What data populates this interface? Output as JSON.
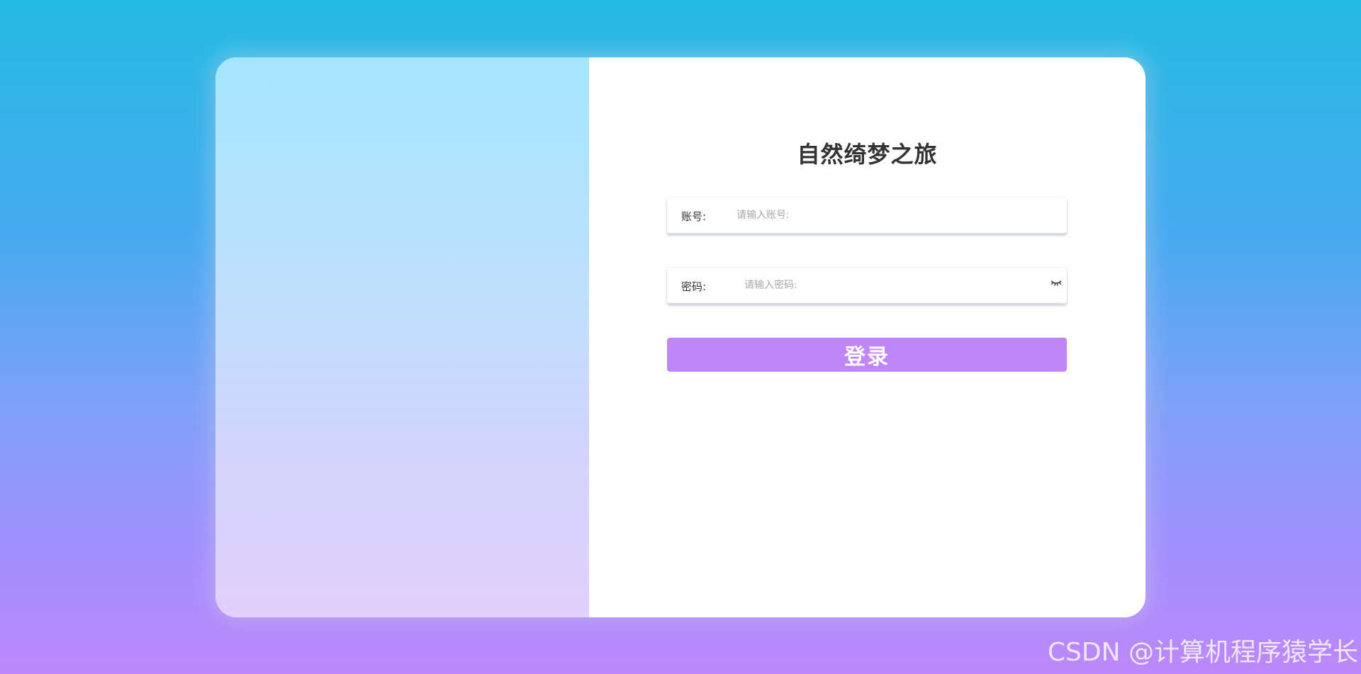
{
  "login": {
    "title": "自然绮梦之旅",
    "account": {
      "label": "账号:",
      "placeholder": "请输入账号:",
      "value": ""
    },
    "password": {
      "label": "密码:",
      "placeholder": "请输入密码:",
      "value": "",
      "toggle_icon": "eye-closed-icon"
    },
    "submit_label": "登录"
  },
  "watermark": "CSDN @计算机程序猿学长",
  "colors": {
    "button": "#be86f9",
    "title_text": "#333333",
    "left_panel_top": "#a4e6fd",
    "left_panel_bottom": "#e2d0fe",
    "background_top": "#24bae2",
    "background_bottom": "#bd88fc"
  }
}
